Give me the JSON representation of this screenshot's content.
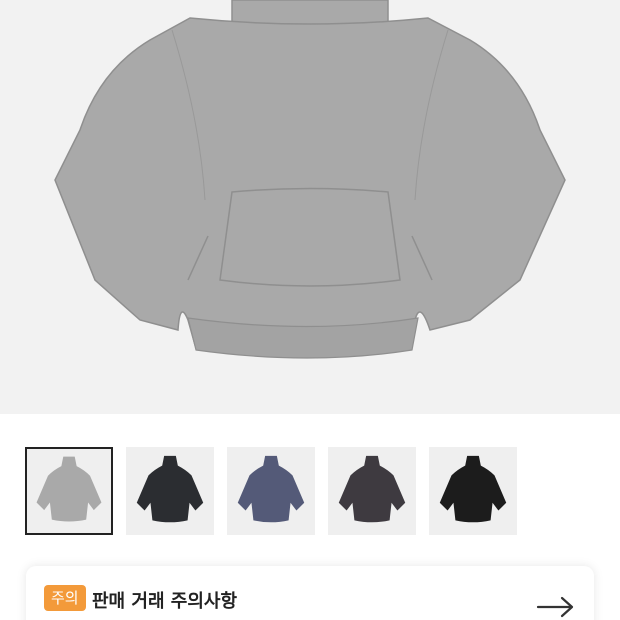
{
  "product": {
    "main_image": {
      "icon": "hoodie-icon",
      "color": "#a9a9a9"
    },
    "thumbnails": [
      {
        "icon": "hoodie-icon",
        "color": "#a9a9a9",
        "selected": true
      },
      {
        "icon": "hoodie-icon",
        "color": "#2b2d31",
        "selected": false
      },
      {
        "icon": "hoodie-icon",
        "color": "#545a78",
        "selected": false
      },
      {
        "icon": "hoodie-icon",
        "color": "#3e3a40",
        "selected": false
      },
      {
        "icon": "hoodie-icon",
        "color": "#1c1c1c",
        "selected": false
      }
    ]
  },
  "notice": {
    "badge": "주의",
    "title": "판매 거래 주의사항",
    "arrow_icon": "arrow-right-icon"
  },
  "colors": {
    "badge_bg": "#f39a3a",
    "hero_bg": "#f2f2f2"
  }
}
